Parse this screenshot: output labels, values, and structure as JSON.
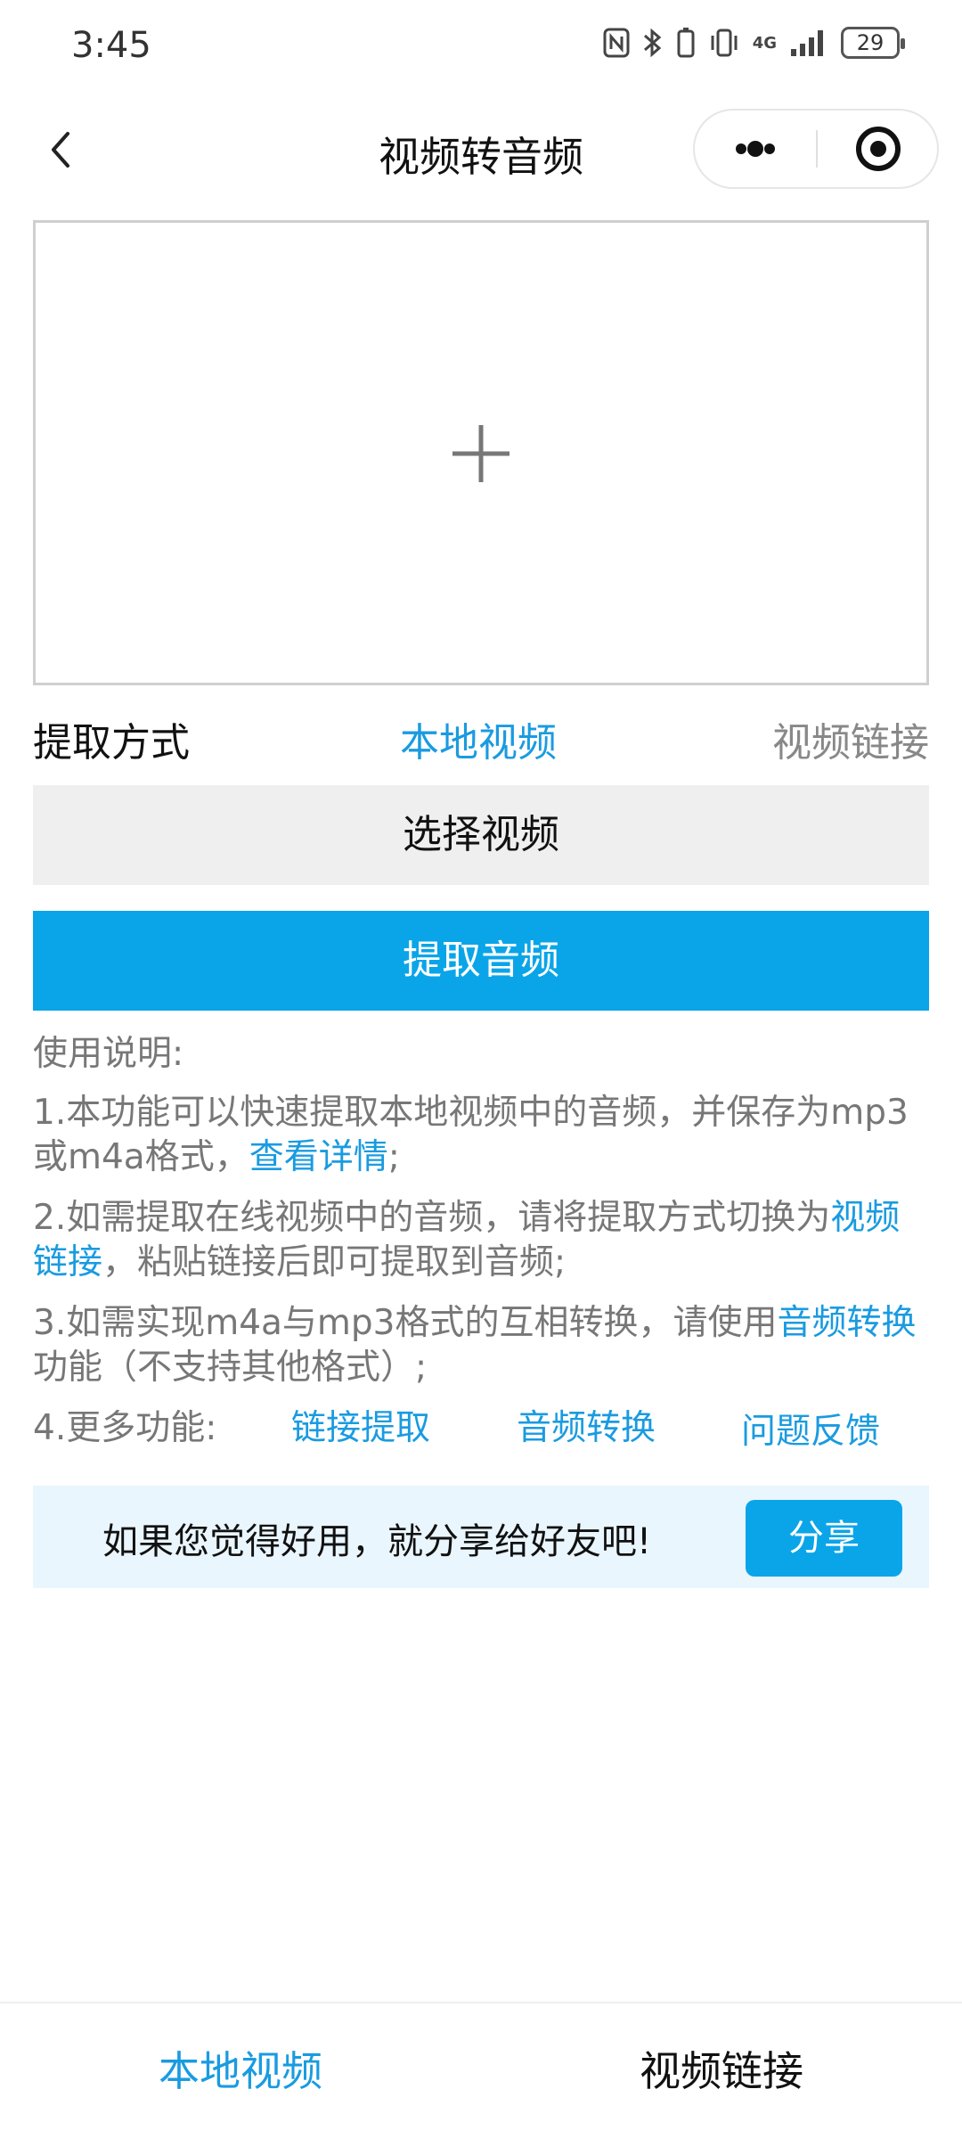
{
  "status_bar": {
    "time": "3:45",
    "battery": "29",
    "network": "4G"
  },
  "nav": {
    "title": "视频转音频",
    "back_icon": "chevron-left-icon",
    "more_icon": "more-dots-icon",
    "close_icon": "target-close-icon"
  },
  "upload": {
    "icon": "plus-icon"
  },
  "mode": {
    "label": "提取方式",
    "local": "本地视频",
    "link": "视频链接",
    "selected": "本地视频"
  },
  "buttons": {
    "select_video": "选择视频",
    "extract_audio": "提取音频"
  },
  "instructions": {
    "title": "使用说明:",
    "item1_text": "1.本功能可以快速提取本地视频中的音频，并保存为mp3或m4a格式，",
    "item1_link": "查看详情",
    "item1_end": ";",
    "item2_text": "2.如需提取在线视频中的音频，请将提取方式切换为",
    "item2_link": "视频链接",
    "item2_end": "，粘贴链接后即可提取到音频;",
    "item3_text": "3.如需实现m4a与mp3格式的互相转换，请使用",
    "item3_link": "音频转换",
    "item3_end": "功能（不支持其他格式）;",
    "item4_label": "4.更多功能:",
    "item4_links": [
      "链接提取",
      "音频转换",
      "问题反馈"
    ]
  },
  "share": {
    "text": "如果您觉得好用，就分享给好友吧!",
    "button": "分享"
  },
  "tabbar": {
    "local": "本地视频",
    "link": "视频链接",
    "active": "本地视频"
  },
  "colors": {
    "accent": "#0aa5e8",
    "link": "#1a9be0",
    "muted": "#777777",
    "share_bg": "#eaf6fd"
  }
}
